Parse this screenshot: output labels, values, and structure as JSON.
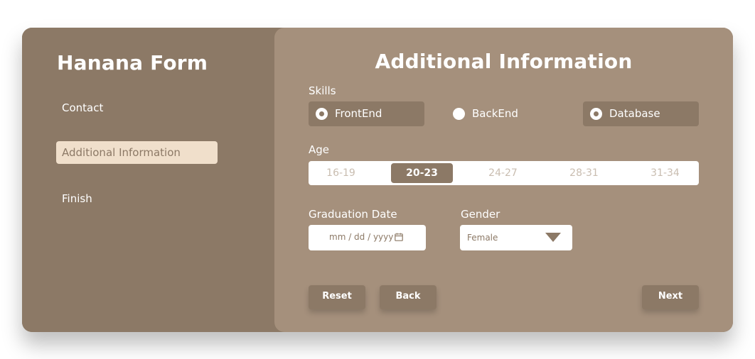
{
  "app": {
    "brand": "Hanana Form"
  },
  "sidebar": {
    "items": [
      {
        "label": "Contact",
        "active": false
      },
      {
        "label": "Additional Information",
        "active": true
      },
      {
        "label": "Finish",
        "active": false
      }
    ]
  },
  "main": {
    "title": "Additional Information",
    "skills": {
      "label": "Skills",
      "options": [
        {
          "label": "FrontEnd",
          "checked": true
        },
        {
          "label": "BackEnd",
          "checked": false
        },
        {
          "label": "Database",
          "checked": true
        }
      ]
    },
    "age": {
      "label": "Age",
      "options": [
        "16-19",
        "20-23",
        "24-27",
        "28-31",
        "31-34"
      ],
      "selected": "20-23"
    },
    "graduation": {
      "label": "Graduation Date",
      "placeholder": "mm / dd / yyyy",
      "icon": "calendar-icon"
    },
    "gender": {
      "label": "Gender",
      "value": "Female",
      "icon": "chevron-down-icon"
    },
    "buttons": {
      "reset": "Reset",
      "back": "Back",
      "next": "Next"
    }
  },
  "colors": {
    "sidebar_bg": "#8c7966",
    "main_bg": "#a5907c",
    "active_nav_bg": "#f0dfcb",
    "white": "#ffffff"
  }
}
